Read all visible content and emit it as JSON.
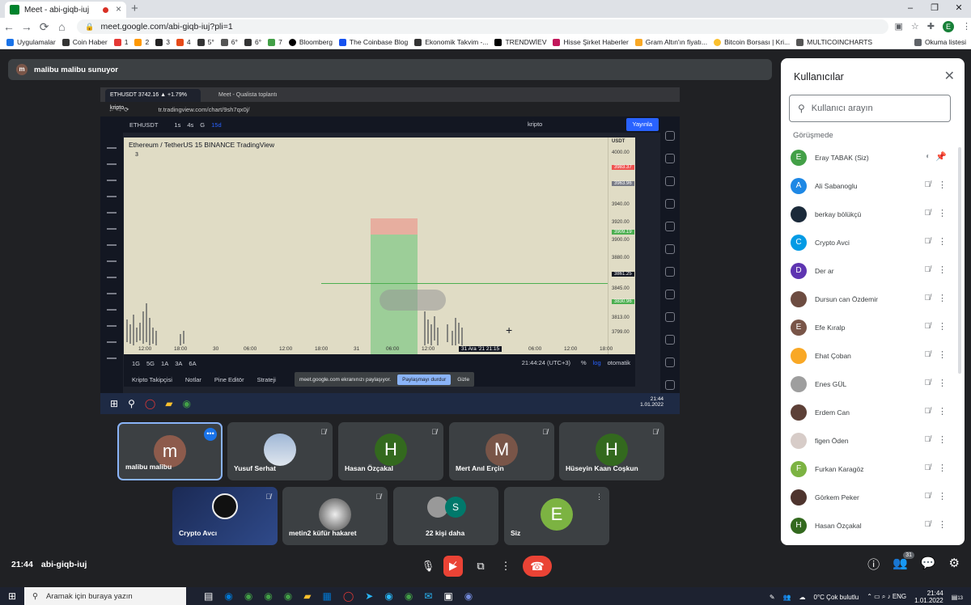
{
  "browser": {
    "tab_title": "Meet - abi-giqb-iuj",
    "url": "meet.google.com/abi-giqb-iuj?pli=1",
    "profile_initial": "E",
    "bookmarks": [
      "Uygulamalar",
      "Coin Haber",
      "1",
      "2",
      "3",
      "4",
      "5°",
      "6°",
      "6°",
      "7",
      "Bloomberg",
      "The Coinbase Blog",
      "Ekonomik Takvim -...",
      "TRENDWİEV",
      "Hisse Şirket Haberler",
      "Gram Altın'ın fiyatı...",
      "Bitcoin Borsası | Kri...",
      "MULTICOINCHARTS"
    ],
    "reading_list": "Okuma listesi"
  },
  "meet": {
    "presenter_initial": "m",
    "presenter_text": "malibu malibu sunuyor",
    "meeting_time": "21:44",
    "meeting_code": "abi-giqb-iuj",
    "participant_count": "31"
  },
  "shared_screen": {
    "tab1": "ETHUSDT 3742.16 ▲ +1.79% kripto",
    "tab2": "Meet - Qualista toplantı",
    "url": "tr.tradingview.com/chart/9sh7qx0j/",
    "symbol": "ETHUSDT",
    "timeframes": [
      "1s",
      "4s",
      "G",
      "15d"
    ],
    "indicator_label": "kripto",
    "publish_label": "Yayınla",
    "chart_title": "Ethereum / TetherUS  15  BINANCE  TradingView",
    "chart_sub": "3",
    "currency": "USDT",
    "prices": [
      "4000.00",
      "3983.37",
      "3963.96",
      "3940.00",
      "3920.00",
      "3909.19",
      "3900.00",
      "3880.00",
      "3861.25",
      "3845.00",
      "3830.96",
      "3813.00",
      "3799.00"
    ],
    "xaxis": [
      "12:00",
      "18:00",
      "30",
      "06:00",
      "12:00",
      "18:00",
      "31",
      "06:00",
      "12:00",
      "31 Ara '21  21:15",
      "06:00",
      "12:00",
      "18:00"
    ],
    "ranges": [
      "1G",
      "5G",
      "1A",
      "3A",
      "6A"
    ],
    "chart_clock": "21:44:24 (UTC+3)",
    "scale_options": [
      "%",
      "log",
      "otomatik"
    ],
    "bottom_tabs": [
      "Kripto Takipçisi",
      "Notlar",
      "Pine Editör",
      "Strateji"
    ],
    "share_notice": "meet.google.com ekranınızı paylaşıyor.",
    "stop_share": "Paylaşmayı durdur",
    "hide": "Gizle",
    "win_time": "21:44",
    "win_date": "1.01.2022"
  },
  "tiles": [
    {
      "name": "malibu malibu",
      "initial": "m",
      "color": "#8d5b4c"
    },
    {
      "name": "Yusuf Serhat",
      "initial": "",
      "color": "#7b95b8"
    },
    {
      "name": "Hasan Özçakal",
      "initial": "H",
      "color": "#33691e"
    },
    {
      "name": "Mert Anıl Erçin",
      "initial": "M",
      "color": "#795548"
    },
    {
      "name": "Hüseyin Kaan Coşkun",
      "initial": "H",
      "color": "#33691e"
    },
    {
      "name": "Crypto Avcı",
      "initial": "",
      "color": "#222"
    },
    {
      "name": "metin2 küfür hakaret",
      "initial": "",
      "color": "#555"
    },
    {
      "name": "22 kişi daha",
      "initial": "S",
      "color": "#00796b"
    },
    {
      "name": "Siz",
      "initial": "E",
      "color": "#7cb342"
    }
  ],
  "panel": {
    "title": "Kullanıcılar",
    "search_placeholder": "Kullanıcı arayın",
    "section": "Görüşmede",
    "participants": [
      {
        "name": "Eray TABAK (Siz)",
        "initial": "E",
        "color": "#43a047"
      },
      {
        "name": "Ali Sabanoglu",
        "initial": "A",
        "color": "#1e88e5"
      },
      {
        "name": "berkay bölükçü",
        "initial": "",
        "color": "#1b2a3a"
      },
      {
        "name": "Crypto Avci",
        "initial": "C",
        "color": "#039be5"
      },
      {
        "name": "Der ar",
        "initial": "D",
        "color": "#5e35b1"
      },
      {
        "name": "Dursun can Özdemir",
        "initial": "",
        "color": "#6d4c41"
      },
      {
        "name": "Efe Kıralp",
        "initial": "E",
        "color": "#795548"
      },
      {
        "name": "Ehat Çoban",
        "initial": "",
        "color": "#f9a825"
      },
      {
        "name": "Enes GÜL",
        "initial": "",
        "color": "#9e9e9e"
      },
      {
        "name": "Erdem Can",
        "initial": "",
        "color": "#5d4037"
      },
      {
        "name": "figen Öden",
        "initial": "",
        "color": "#d7ccc8"
      },
      {
        "name": "Furkan Karagöz",
        "initial": "F",
        "color": "#7cb342"
      },
      {
        "name": "Görkem Peker",
        "initial": "",
        "color": "#4e342e"
      },
      {
        "name": "Hasan Özçakal",
        "initial": "H",
        "color": "#33691e"
      }
    ]
  },
  "taskbar": {
    "search_placeholder": "Aramak için buraya yazın",
    "weather": "0°C  Çok bulutlu",
    "time": "21:44",
    "date": "1.01.2022",
    "notif": "13"
  }
}
